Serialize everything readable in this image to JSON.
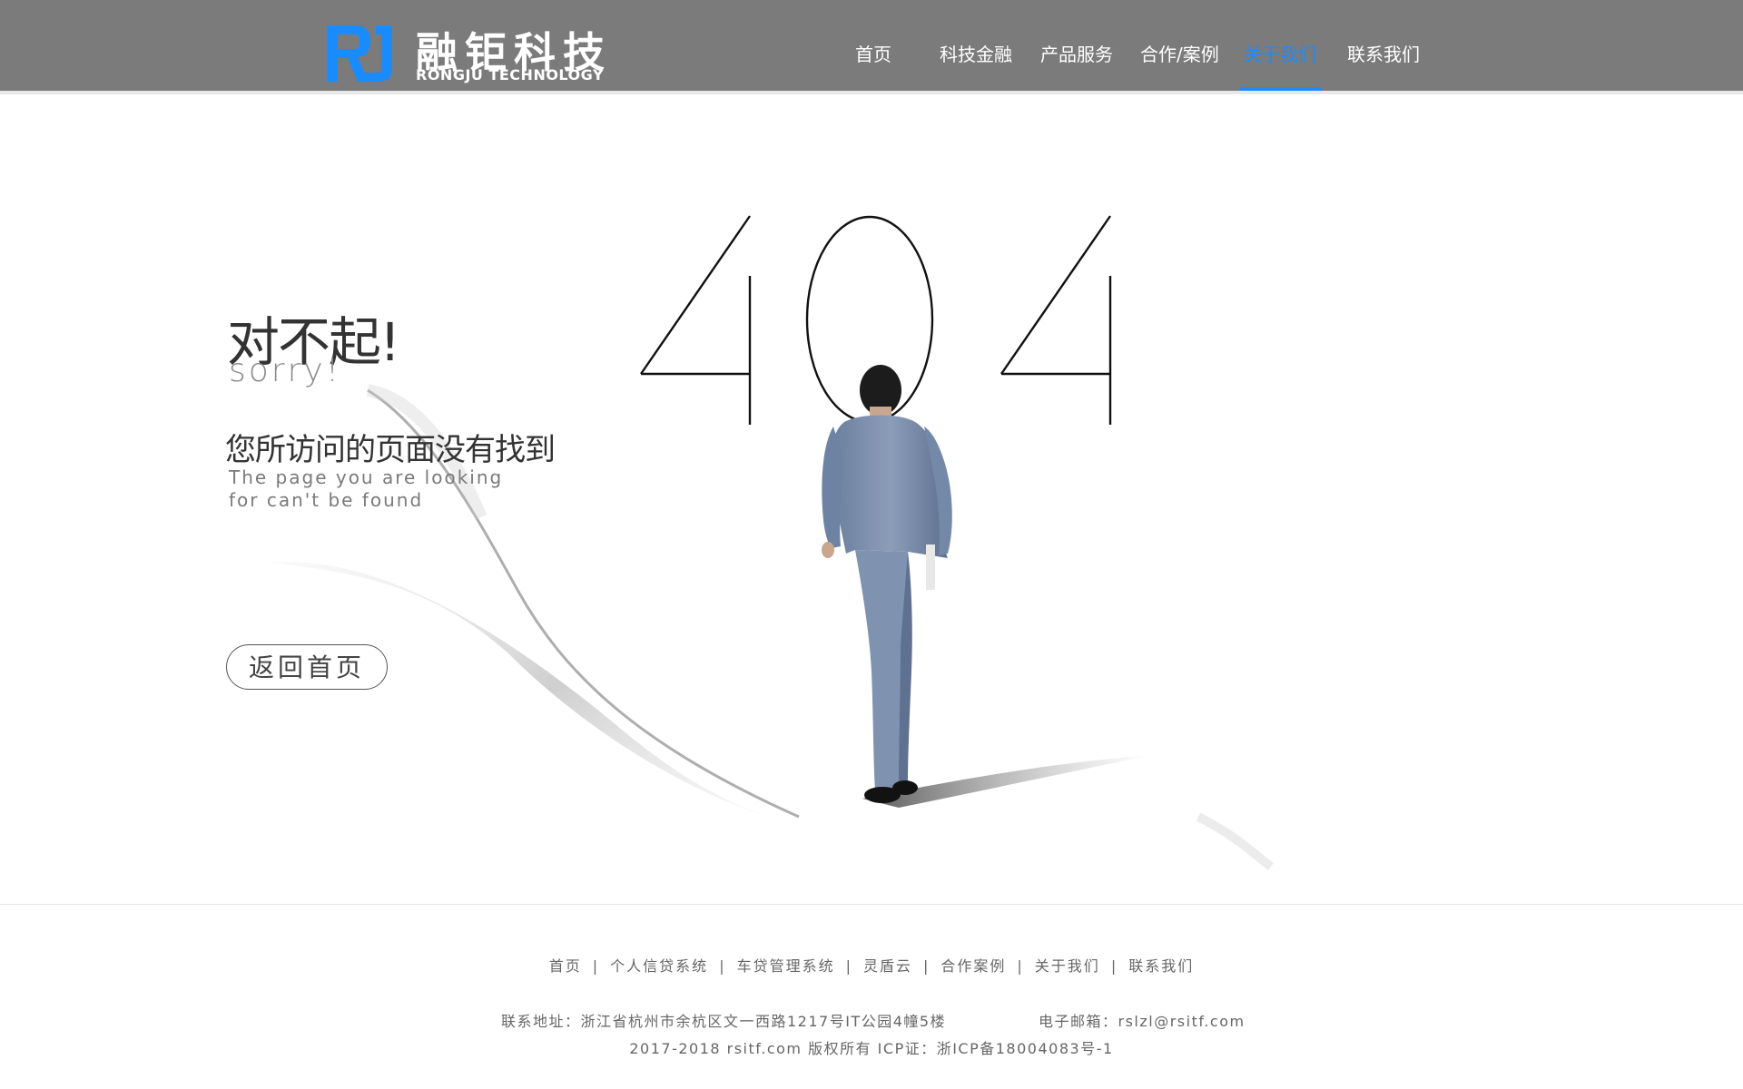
{
  "header": {
    "logo_cn": "融钜科技",
    "logo_en": "RONGJU TECHNOLOGY",
    "nav": [
      {
        "label": "首页"
      },
      {
        "label": "科技金融"
      },
      {
        "label": "产品服务"
      },
      {
        "label": "合作/案例"
      },
      {
        "label": "关于我们",
        "active": true
      },
      {
        "label": "联系我们"
      }
    ]
  },
  "main": {
    "big_number": "404",
    "sorry_cn": "对不起!",
    "sorry_en": "sorry!",
    "notfound_cn": "您所访问的页面没有找到",
    "notfound_en": "The page you are looking for can't be found",
    "back_button": "返回首页"
  },
  "footer": {
    "links": [
      "首页",
      "个人信贷系统",
      "车贷管理系统",
      "灵盾云",
      "合作案例",
      "关于我们",
      "联系我们"
    ],
    "separator": "|",
    "address": "联系地址：浙江省杭州市余杭区文一西路1217号IT公园4幢5楼",
    "email": "电子邮箱：rslzl@rsitf.com",
    "copyright": "2017-2018 rsitf.com 版权所有 ICP证：浙ICP备18004083号-1"
  },
  "colors": {
    "header_bg": "#7b7b7b",
    "accent": "#1a8cff",
    "text_dark": "#333333",
    "text_muted": "#666666"
  },
  "icons": [
    "rj-logo-mark"
  ]
}
